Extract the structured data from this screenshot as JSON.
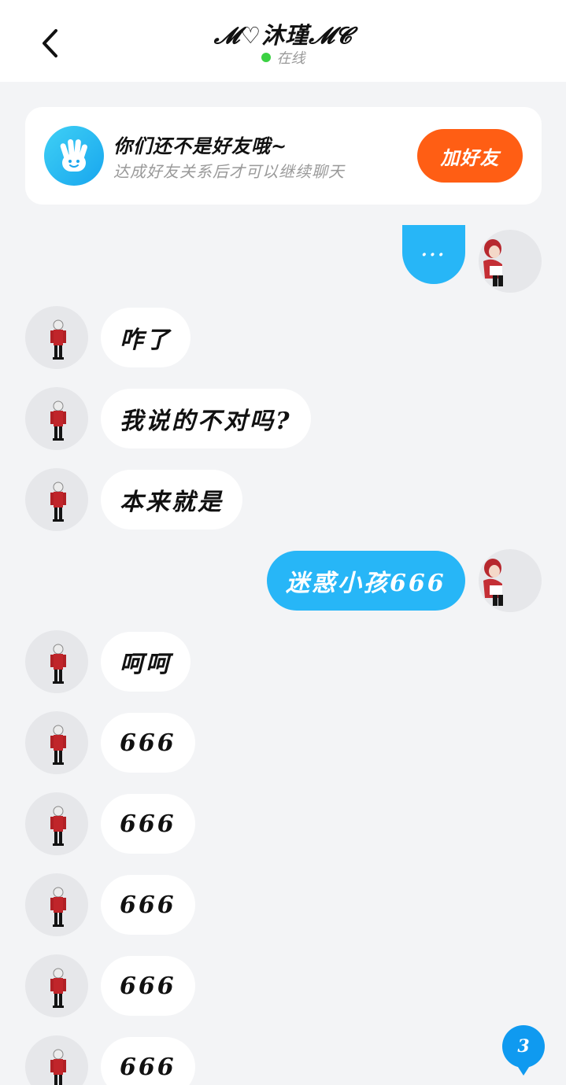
{
  "header": {
    "title": "𝓜♡沐瑾𝓜𝓒",
    "status_text": "在线",
    "status_color": "#3bd143"
  },
  "banner": {
    "title": "你们还不是好友哦~",
    "subtitle": "达成好友关系后才可以继续聊天",
    "add_button_label": "加好友",
    "icon": "hand-wave-icon"
  },
  "messages": [
    {
      "side": "right",
      "text": "···"
    },
    {
      "side": "left",
      "text": "咋了"
    },
    {
      "side": "left",
      "text": "我说的不对吗?"
    },
    {
      "side": "left",
      "text": "本来就是"
    },
    {
      "side": "right",
      "text": "迷惑小孩666"
    },
    {
      "side": "left",
      "text": "呵呵"
    },
    {
      "side": "left",
      "text": "666"
    },
    {
      "side": "left",
      "text": "666"
    },
    {
      "side": "left",
      "text": "666"
    },
    {
      "side": "left",
      "text": "666"
    },
    {
      "side": "left",
      "text": "666"
    }
  ],
  "new_messages_badge": "3",
  "colors": {
    "accent_blue": "#27b6f7",
    "add_button": "#ff5e14",
    "background": "#f3f4f6"
  }
}
